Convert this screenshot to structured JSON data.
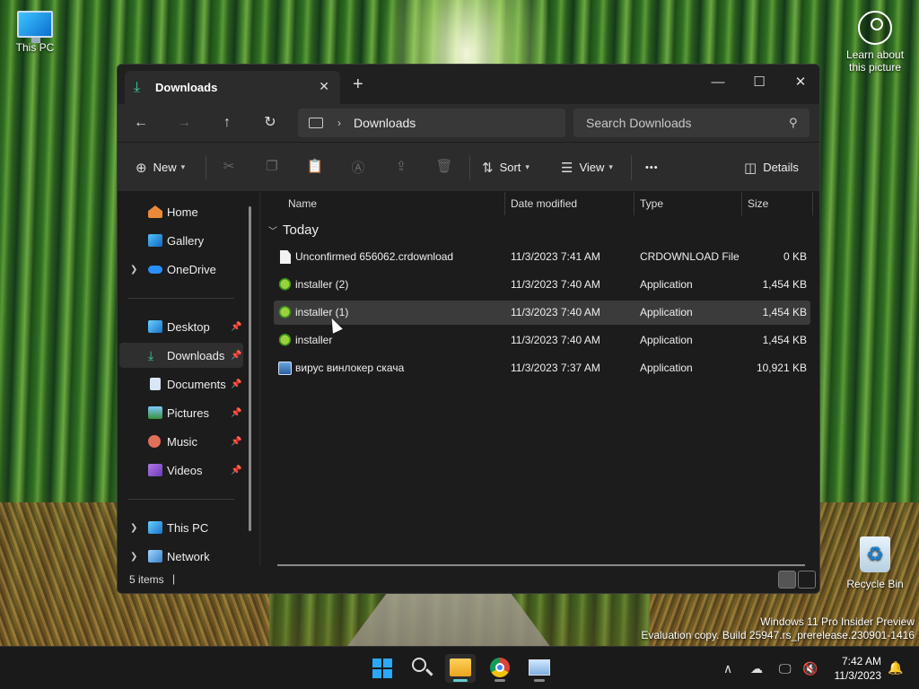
{
  "desktop": {
    "this_pc": "This PC",
    "recycle_bin": "Recycle Bin",
    "learn_line1": "Learn about",
    "learn_line2": "this picture",
    "watermark_line1": "Windows 11 Pro Insider Preview",
    "watermark_line2": "Evaluation copy. Build 25947.rs_prerelease.230901-1416"
  },
  "window": {
    "tab_title": "Downloads",
    "tab_close": "✕",
    "new_tab": "+",
    "minimize": "—",
    "maximize": "☐",
    "close": "✕"
  },
  "nav": {
    "back": "←",
    "forward": "→",
    "up": "↑",
    "refresh": "↻",
    "crumb_sep": "›",
    "breadcrumb": "Downloads",
    "search_placeholder": "Search Downloads",
    "search_icon": "⚲"
  },
  "toolbar": {
    "new_label": "New",
    "sort_label": "Sort",
    "view_label": "View",
    "more": "•••",
    "details_label": "Details",
    "icons": [
      "cut-icon",
      "copy-icon",
      "paste-icon",
      "rename-icon",
      "share-icon",
      "delete-icon"
    ]
  },
  "sidebar": {
    "items": [
      {
        "label": "Home"
      },
      {
        "label": "Gallery"
      },
      {
        "label": "OneDrive"
      },
      {
        "label": "Desktop"
      },
      {
        "label": "Downloads"
      },
      {
        "label": "Documents"
      },
      {
        "label": "Pictures"
      },
      {
        "label": "Music"
      },
      {
        "label": "Videos"
      },
      {
        "label": "This PC"
      },
      {
        "label": "Network"
      }
    ]
  },
  "columns": {
    "name": "Name",
    "date": "Date modified",
    "type": "Type",
    "size": "Size"
  },
  "group": {
    "label": "Today"
  },
  "files": [
    {
      "name": "Unconfirmed 656062.crdownload",
      "date": "11/3/2023 7:41 AM",
      "type": "CRDOWNLOAD File",
      "size": "0 KB"
    },
    {
      "name": "installer (2)",
      "date": "11/3/2023 7:40 AM",
      "type": "Application",
      "size": "1,454 KB"
    },
    {
      "name": "installer (1)",
      "date": "11/3/2023 7:40 AM",
      "type": "Application",
      "size": "1,454 KB"
    },
    {
      "name": "installer",
      "date": "11/3/2023 7:40 AM",
      "type": "Application",
      "size": "1,454 KB"
    },
    {
      "name": "вирус винлокер скача",
      "date": "11/3/2023 7:37 AM",
      "type": "Application",
      "size": "10,921 KB"
    }
  ],
  "status": {
    "count": "5 items",
    "caret": "|"
  },
  "taskbar": {
    "time": "7:42 AM",
    "date": "11/3/2023",
    "tray_chevron": "∧",
    "bell": "🔔"
  },
  "colors": {
    "accent": "#3dd0a0",
    "window_bg": "#1c1c1c",
    "toolbar_bg": "#2c2c2c"
  }
}
